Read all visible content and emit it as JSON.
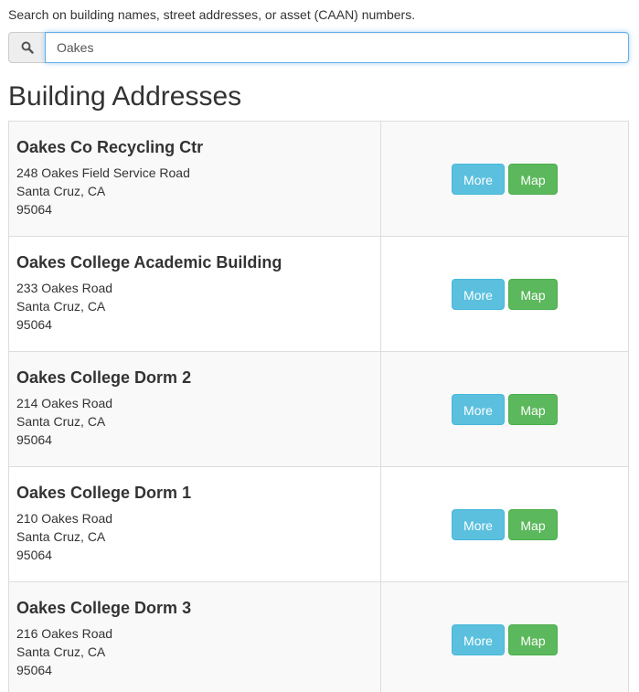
{
  "search": {
    "instructions": "Search on building names, street addresses, or asset (CAAN) numbers.",
    "value": "Oakes",
    "icon": "search-icon"
  },
  "section_title": "Building Addresses",
  "buttons": {
    "more_label": "More",
    "map_label": "Map"
  },
  "colors": {
    "more_button": "#5bc0de",
    "map_button": "#5cb85c",
    "row_stripe": "#f9f9f9",
    "input_focus": "#66afe9"
  },
  "buildings": [
    {
      "name": "Oakes Co Recycling Ctr",
      "street": "248 Oakes Field Service Road",
      "city": "Santa Cruz, CA",
      "zip": "95064"
    },
    {
      "name": "Oakes College Academic Building",
      "street": "233 Oakes Road",
      "city": "Santa Cruz, CA",
      "zip": "95064"
    },
    {
      "name": "Oakes College Dorm 2",
      "street": "214 Oakes Road",
      "city": "Santa Cruz, CA",
      "zip": "95064"
    },
    {
      "name": "Oakes College Dorm 1",
      "street": "210 Oakes Road",
      "city": "Santa Cruz, CA",
      "zip": "95064"
    },
    {
      "name": "Oakes College Dorm 3",
      "street": "216 Oakes Road",
      "city": "Santa Cruz, CA",
      "zip": "95064"
    }
  ]
}
